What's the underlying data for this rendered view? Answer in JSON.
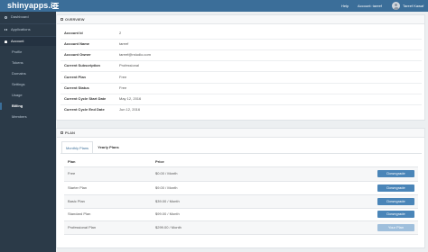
{
  "header": {
    "logo": "shinyapps.io",
    "help": "Help",
    "account": "Account: tareef",
    "user": "Tareef Kawaf"
  },
  "sidebar": {
    "items": [
      {
        "label": "Dashboard",
        "icon": "dashboard-icon"
      },
      {
        "label": "Applications",
        "icon": "applications-icon"
      },
      {
        "label": "Account",
        "icon": "account-icon"
      }
    ],
    "account_items": [
      {
        "label": "Profile"
      },
      {
        "label": "Tokens"
      },
      {
        "label": "Domains"
      },
      {
        "label": "Settings"
      },
      {
        "label": "Usage"
      },
      {
        "label": "Billing"
      },
      {
        "label": "Members"
      }
    ]
  },
  "overview": {
    "title": "OVERVIEW",
    "rows": [
      {
        "label": "Account Id",
        "value": "2"
      },
      {
        "label": "Account Name",
        "value": "tareef"
      },
      {
        "label": "Account Owner",
        "value": "tareef@rstudio.com"
      },
      {
        "label": "Current Subscription",
        "value": "Professional"
      },
      {
        "label": "Current Plan",
        "value": "Free"
      },
      {
        "label": "Current Status",
        "value": "Free"
      },
      {
        "label": "Current Cycle Start Date",
        "value": "May 12, 2016"
      },
      {
        "label": "Current Cycle End Date",
        "value": "Jun 12, 2016"
      }
    ]
  },
  "plan": {
    "title": "PLAN",
    "tabs": [
      {
        "label": "Monthly Plans"
      },
      {
        "label": "Yearly Plans"
      }
    ],
    "columns": {
      "plan": "Plan",
      "price": "Price"
    },
    "rows": [
      {
        "plan": "Free",
        "price": "$0.00 / Month",
        "action": "Downgrade"
      },
      {
        "plan": "Starter Plan",
        "price": "$9.00 / Month",
        "action": "Downgrade"
      },
      {
        "plan": "Basic Plan",
        "price": "$39.00 / Month",
        "action": "Downgrade"
      },
      {
        "plan": "Standard Plan",
        "price": "$99.00 / Month",
        "action": "Downgrade"
      },
      {
        "plan": "Professional Plan",
        "price": "$299.00 / Month",
        "action": "Your Plan"
      }
    ]
  },
  "colors": {
    "brand": "#3b6e99",
    "sidebar": "#2b3a48",
    "button": "#4a85b8",
    "button_current": "#9fbfdc"
  }
}
